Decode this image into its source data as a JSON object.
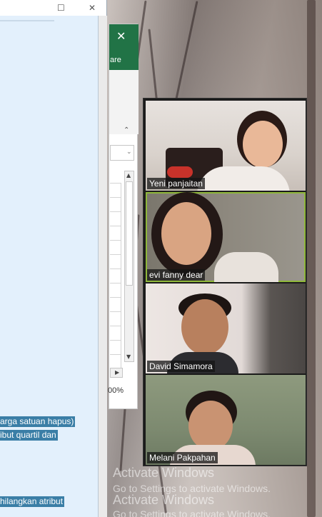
{
  "document": {
    "highlight_1": "arga satuan hapus)",
    "highlight_2": "ibut quartil dan",
    "highlight_3": "hilangkan atribut"
  },
  "excel": {
    "share_label": "are",
    "zoom": "00%"
  },
  "participants": [
    {
      "name": "Yeni panjaitan"
    },
    {
      "name": "evi fanny dear"
    },
    {
      "name": "David Simamora"
    },
    {
      "name": "Melani Pakpahan"
    }
  ],
  "watermark": {
    "line1": "Activate Windows",
    "line2": "Go to Settings to activate Windows.",
    "line3": "Activate Windows",
    "line4": "Go to Settings to activate Windows."
  },
  "colors": {
    "excel_green": "#217346",
    "active_speaker": "#8fb73a",
    "doc_highlight": "#3a7ea6"
  }
}
